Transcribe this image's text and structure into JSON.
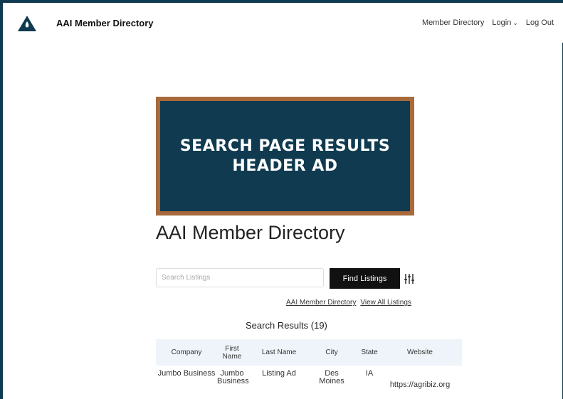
{
  "nav": {
    "brand": "AAI Member Directory",
    "links": [
      "Member Directory",
      "Login",
      "Log Out"
    ]
  },
  "ad": {
    "text": "SEARCH PAGE RESULTS\nHEADER AD"
  },
  "page_title": "AAI Member Directory",
  "search": {
    "placeholder": "Search Listings",
    "value": "",
    "button_label": "Find Listings"
  },
  "links": [
    "AAI Member Directory",
    "View All Listings"
  ],
  "results_heading": "Search Results (19)",
  "table": {
    "headers": [
      "Company",
      "First Name",
      "Last Name",
      "City",
      "State",
      "Website"
    ],
    "rows": [
      [
        "Jumbo Business",
        "Jumbo Business",
        "Listing Ad",
        "Des Moines",
        "IA",
        "https://agribiz.org"
      ]
    ]
  },
  "colors": {
    "brand_dark": "#0f3a4f",
    "ad_border": "#a86a3c",
    "table_header_bg": "#eef4f9"
  },
  "icons": [
    "logo-icon",
    "chevron-down-icon",
    "filter-sliders-icon"
  ]
}
